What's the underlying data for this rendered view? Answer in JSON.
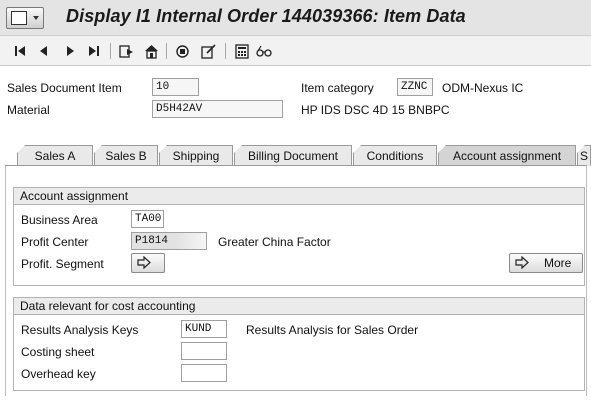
{
  "window": {
    "title": "Display I1 Internal Order 144039366: Item Data"
  },
  "toolbar": {
    "icons": [
      "first-page-icon",
      "previous-page-icon",
      "next-page-icon",
      "last-page-icon",
      "other-item-icon",
      "header-icon",
      "item-overview-icon",
      "document-flow-icon",
      "calculator-icon",
      "glasses-icon"
    ]
  },
  "header": {
    "sales_doc_item_label": "Sales Document Item",
    "sales_doc_item_value": "10",
    "item_category_label": "Item category",
    "item_category_value": "ZZNC",
    "item_category_desc": "ODM-Nexus IC",
    "material_label": "Material",
    "material_value": "D5H42AV",
    "material_desc": "HP IDS DSC 4D 15 BNBPC"
  },
  "tabs": [
    {
      "label": "Sales A"
    },
    {
      "label": "Sales B"
    },
    {
      "label": "Shipping"
    },
    {
      "label": "Billing Document"
    },
    {
      "label": "Conditions"
    },
    {
      "label": "Account assignment"
    },
    {
      "label": "S"
    }
  ],
  "active_tab": "Account assignment",
  "account_assignment": {
    "title": "Account assignment",
    "business_area_label": "Business Area",
    "business_area_value": "TA00",
    "profit_center_label": "Profit Center",
    "profit_center_value": "P1814",
    "profit_center_desc": "Greater China Factor",
    "profit_segment_label": "Profit. Segment",
    "more_label": "More"
  },
  "cost_accounting": {
    "title": "Data relevant for cost accounting",
    "results_analysis_label": "Results Analysis Keys",
    "results_analysis_value": "KUND",
    "results_analysis_desc": "Results Analysis for Sales Order",
    "costing_sheet_label": "Costing sheet",
    "costing_sheet_value": "",
    "overhead_key_label": "Overhead key",
    "overhead_key_value": ""
  }
}
